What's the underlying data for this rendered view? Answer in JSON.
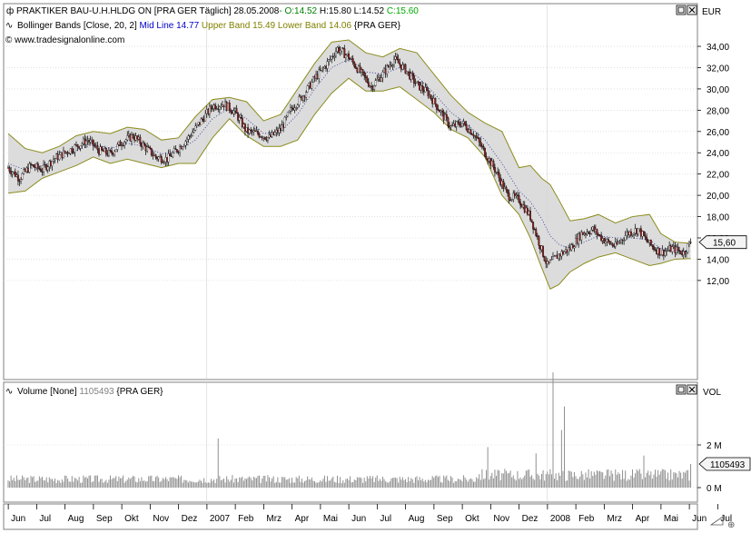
{
  "header": {
    "symbol_icon": "candlestick-icon",
    "title": "PRAKTIKER BAU-U.H.HLDG ON [PRA GER  Täglich] 28.05.2008",
    "open": "- O:14.52",
    "high": " H:15.80",
    "low": " L:14.52",
    "close": " C:15.60",
    "indicator_icon": "wave-icon",
    "indicator": "Bollinger Bands [Close, 20, 2]",
    "mid_line": "Mid Line 14.77",
    "upper_band": "Upper Band 15.49",
    "lower_band": "Lower Band 14.06",
    "indicator_exchange": "{PRA GER}",
    "copyright": "© www.tradesignalonline.com",
    "currency": "EUR"
  },
  "volume_header": {
    "label": "Volume [None]",
    "value": "1105493",
    "exchange": "{PRA GER}",
    "axis_title": "VOL"
  },
  "colors": {
    "background": "#ffffff",
    "panel_border": "#808080",
    "grid": "#d0d0d0",
    "band_fill": "#d6d6d6",
    "band_line": "#8c8c1e",
    "mid_line": "#2a2aa0",
    "candle_up": "#e8e8e8",
    "candle_down": "#303030",
    "wick": "#000000",
    "volume_bar": "#909090",
    "open_green": "#008000",
    "close_green": "#00aa00",
    "mid_blue": "#0000cc",
    "band_olive": "#808000"
  },
  "chart_data": [
    {
      "type": "candlestick",
      "title": "PRAKTIKER BAU-U.H.HLDG ON",
      "xlabel": "",
      "ylabel": "EUR",
      "ylim": [
        10.4,
        35.4
      ],
      "y_ticks": [
        12,
        14,
        16,
        18,
        20,
        22,
        24,
        26,
        28,
        30,
        32,
        34
      ],
      "y_tick_labels": [
        "12,00",
        "14,00",
        "16,00",
        "18,00",
        "20,00",
        "22,00",
        "24,00",
        "26,00",
        "28,00",
        "30,00",
        "32,00",
        "34,00"
      ],
      "last_price": 15.6,
      "last_price_label": "15,60",
      "grid": true,
      "x_month_labels": [
        "Jun",
        "Jul",
        "Aug",
        "Sep",
        "Okt",
        "Nov",
        "Dez",
        "2007",
        "Feb",
        "Mrz",
        "Apr",
        "Mai",
        "Jun",
        "Jul",
        "Aug",
        "Sep",
        "Okt",
        "Nov",
        "Dez",
        "2008",
        "Feb",
        "Mrz",
        "Apr",
        "Mai",
        "Jun",
        "Jul"
      ],
      "price_points": [
        {
          "m": 0.0,
          "p": 22.6
        },
        {
          "m": 0.4,
          "p": 21.6
        },
        {
          "m": 0.8,
          "p": 22.8
        },
        {
          "m": 1.2,
          "p": 22.4
        },
        {
          "m": 1.6,
          "p": 23.4
        },
        {
          "m": 2.0,
          "p": 24.0
        },
        {
          "m": 2.4,
          "p": 24.6
        },
        {
          "m": 2.8,
          "p": 25.2
        },
        {
          "m": 3.2,
          "p": 24.2
        },
        {
          "m": 3.6,
          "p": 23.9
        },
        {
          "m": 4.0,
          "p": 25.0
        },
        {
          "m": 4.4,
          "p": 25.6
        },
        {
          "m": 4.8,
          "p": 24.6
        },
        {
          "m": 5.2,
          "p": 23.6
        },
        {
          "m": 5.6,
          "p": 23.4
        },
        {
          "m": 6.0,
          "p": 24.4
        },
        {
          "m": 6.4,
          "p": 25.6
        },
        {
          "m": 6.8,
          "p": 27.0
        },
        {
          "m": 7.2,
          "p": 28.4
        },
        {
          "m": 7.6,
          "p": 28.6
        },
        {
          "m": 8.0,
          "p": 27.8
        },
        {
          "m": 8.4,
          "p": 26.0
        },
        {
          "m": 8.8,
          "p": 25.8
        },
        {
          "m": 9.2,
          "p": 25.4
        },
        {
          "m": 9.6,
          "p": 26.2
        },
        {
          "m": 10.0,
          "p": 28.2
        },
        {
          "m": 10.4,
          "p": 29.4
        },
        {
          "m": 10.8,
          "p": 31.0
        },
        {
          "m": 11.2,
          "p": 32.2
        },
        {
          "m": 11.6,
          "p": 33.8
        },
        {
          "m": 12.0,
          "p": 33.0
        },
        {
          "m": 12.4,
          "p": 31.6
        },
        {
          "m": 12.8,
          "p": 30.2
        },
        {
          "m": 13.2,
          "p": 31.4
        },
        {
          "m": 13.6,
          "p": 32.8
        },
        {
          "m": 14.0,
          "p": 31.8
        },
        {
          "m": 14.4,
          "p": 30.4
        },
        {
          "m": 14.8,
          "p": 29.6
        },
        {
          "m": 15.2,
          "p": 28.0
        },
        {
          "m": 15.6,
          "p": 26.4
        },
        {
          "m": 16.0,
          "p": 26.8
        },
        {
          "m": 16.4,
          "p": 25.8
        },
        {
          "m": 16.8,
          "p": 24.0
        },
        {
          "m": 17.2,
          "p": 22.2
        },
        {
          "m": 17.6,
          "p": 20.0
        },
        {
          "m": 18.0,
          "p": 19.6
        },
        {
          "m": 18.4,
          "p": 18.0
        },
        {
          "m": 18.7,
          "p": 15.6
        },
        {
          "m": 19.0,
          "p": 13.4
        },
        {
          "m": 19.4,
          "p": 14.4
        },
        {
          "m": 19.8,
          "p": 15.0
        },
        {
          "m": 20.2,
          "p": 16.4
        },
        {
          "m": 20.6,
          "p": 16.8
        },
        {
          "m": 21.0,
          "p": 15.8
        },
        {
          "m": 21.4,
          "p": 15.2
        },
        {
          "m": 21.8,
          "p": 16.4
        },
        {
          "m": 22.2,
          "p": 16.8
        },
        {
          "m": 22.6,
          "p": 15.4
        },
        {
          "m": 23.0,
          "p": 14.6
        },
        {
          "m": 23.4,
          "p": 15.0
        },
        {
          "m": 23.8,
          "p": 14.6
        },
        {
          "m": 24.05,
          "p": 15.6
        }
      ],
      "band_points": [
        {
          "m": 0.0,
          "up": 25.8,
          "mid": 23.0,
          "lo": 20.2
        },
        {
          "m": 0.6,
          "up": 24.4,
          "mid": 22.4,
          "lo": 20.4
        },
        {
          "m": 1.2,
          "up": 24.0,
          "mid": 22.8,
          "lo": 21.6
        },
        {
          "m": 1.8,
          "up": 24.6,
          "mid": 23.4,
          "lo": 22.2
        },
        {
          "m": 2.4,
          "up": 25.6,
          "mid": 24.2,
          "lo": 22.8
        },
        {
          "m": 3.0,
          "up": 26.0,
          "mid": 24.8,
          "lo": 23.6
        },
        {
          "m": 3.6,
          "up": 25.8,
          "mid": 24.4,
          "lo": 23.0
        },
        {
          "m": 4.2,
          "up": 26.4,
          "mid": 24.9,
          "lo": 23.4
        },
        {
          "m": 4.8,
          "up": 26.2,
          "mid": 24.6,
          "lo": 23.0
        },
        {
          "m": 5.4,
          "up": 25.2,
          "mid": 23.9,
          "lo": 22.6
        },
        {
          "m": 6.0,
          "up": 25.4,
          "mid": 24.2,
          "lo": 23.0
        },
        {
          "m": 6.6,
          "up": 27.4,
          "mid": 25.2,
          "lo": 23.0
        },
        {
          "m": 7.2,
          "up": 29.0,
          "mid": 27.2,
          "lo": 25.4
        },
        {
          "m": 7.8,
          "up": 29.2,
          "mid": 28.2,
          "lo": 27.2
        },
        {
          "m": 8.4,
          "up": 28.8,
          "mid": 27.2,
          "lo": 25.6
        },
        {
          "m": 9.0,
          "up": 27.0,
          "mid": 25.8,
          "lo": 24.6
        },
        {
          "m": 9.6,
          "up": 27.6,
          "mid": 26.0,
          "lo": 24.6
        },
        {
          "m": 10.2,
          "up": 30.0,
          "mid": 27.6,
          "lo": 25.2
        },
        {
          "m": 10.8,
          "up": 32.4,
          "mid": 30.0,
          "lo": 27.6
        },
        {
          "m": 11.4,
          "up": 34.4,
          "mid": 32.0,
          "lo": 29.6
        },
        {
          "m": 12.0,
          "up": 34.6,
          "mid": 32.8,
          "lo": 31.0
        },
        {
          "m": 12.6,
          "up": 33.4,
          "mid": 31.6,
          "lo": 29.8
        },
        {
          "m": 13.2,
          "up": 33.0,
          "mid": 31.4,
          "lo": 29.8
        },
        {
          "m": 13.8,
          "up": 33.8,
          "mid": 32.0,
          "lo": 30.2
        },
        {
          "m": 14.4,
          "up": 33.4,
          "mid": 31.2,
          "lo": 29.0
        },
        {
          "m": 15.0,
          "up": 31.4,
          "mid": 29.6,
          "lo": 27.8
        },
        {
          "m": 15.6,
          "up": 29.4,
          "mid": 27.8,
          "lo": 26.2
        },
        {
          "m": 16.2,
          "up": 27.8,
          "mid": 26.6,
          "lo": 25.4
        },
        {
          "m": 16.8,
          "up": 26.8,
          "mid": 25.2,
          "lo": 23.6
        },
        {
          "m": 17.4,
          "up": 26.0,
          "mid": 23.0,
          "lo": 20.0
        },
        {
          "m": 18.0,
          "up": 22.6,
          "mid": 20.4,
          "lo": 18.2
        },
        {
          "m": 18.4,
          "up": 22.8,
          "mid": 19.4,
          "lo": 16.0
        },
        {
          "m": 18.8,
          "up": 21.6,
          "mid": 17.8,
          "lo": 13.2
        },
        {
          "m": 19.1,
          "up": 21.0,
          "mid": 16.2,
          "lo": 11.2
        },
        {
          "m": 19.4,
          "up": 19.6,
          "mid": 15.4,
          "lo": 11.6
        },
        {
          "m": 19.8,
          "up": 17.6,
          "mid": 15.0,
          "lo": 12.8
        },
        {
          "m": 20.3,
          "up": 17.8,
          "mid": 15.6,
          "lo": 13.6
        },
        {
          "m": 20.8,
          "up": 18.2,
          "mid": 16.2,
          "lo": 14.2
        },
        {
          "m": 21.4,
          "up": 17.4,
          "mid": 16.0,
          "lo": 14.6
        },
        {
          "m": 22.0,
          "up": 18.0,
          "mid": 16.0,
          "lo": 14.0
        },
        {
          "m": 22.6,
          "up": 18.2,
          "mid": 15.8,
          "lo": 13.4
        },
        {
          "m": 23.0,
          "up": 16.4,
          "mid": 15.0,
          "lo": 13.6
        },
        {
          "m": 23.5,
          "up": 15.6,
          "mid": 14.8,
          "lo": 14.0
        },
        {
          "m": 24.05,
          "up": 15.49,
          "mid": 14.77,
          "lo": 14.06
        }
      ]
    },
    {
      "type": "bar",
      "title": "Volume",
      "ylabel": "VOL",
      "ylim": [
        0,
        6000000
      ],
      "y_ticks": [
        0,
        2000000
      ],
      "y_tick_labels": [
        "0 M",
        "2 M"
      ],
      "last_value_label": "1105493",
      "base_volume": 420000,
      "spikes": [
        {
          "m": 7.4,
          "v": 2300000
        },
        {
          "m": 19.2,
          "v": 5400000
        },
        {
          "m": 19.5,
          "v": 2700000
        },
        {
          "m": 19.6,
          "v": 3800000
        },
        {
          "m": 18.6,
          "v": 1600000
        },
        {
          "m": 22.4,
          "v": 1500000
        },
        {
          "m": 16.9,
          "v": 1900000
        },
        {
          "m": 24.05,
          "v": 1105493
        }
      ]
    }
  ]
}
